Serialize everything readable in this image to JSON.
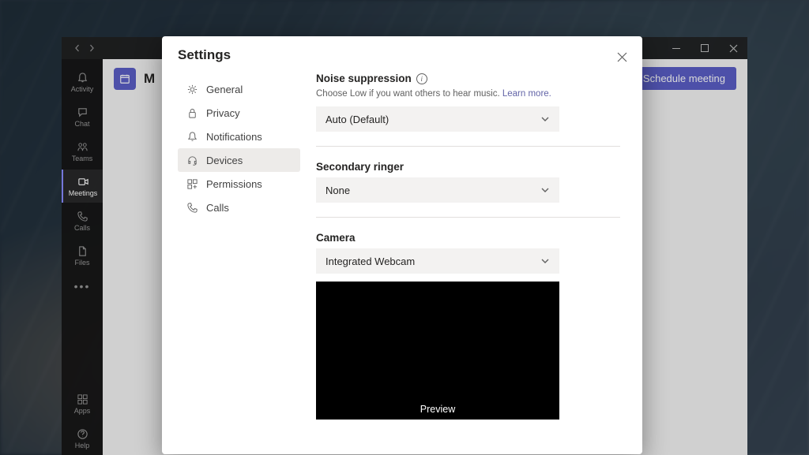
{
  "titlebar": {
    "minimize": "minimize",
    "maximize": "maximize",
    "close": "close"
  },
  "rail": {
    "items": [
      {
        "label": "Activity",
        "icon": "bell"
      },
      {
        "label": "Chat",
        "icon": "chat"
      },
      {
        "label": "Teams",
        "icon": "teams"
      },
      {
        "label": "Meetings",
        "icon": "meetings",
        "active": true
      },
      {
        "label": "Calls",
        "icon": "phone"
      },
      {
        "label": "Files",
        "icon": "files"
      }
    ],
    "bottom": [
      {
        "label": "Apps",
        "icon": "apps"
      },
      {
        "label": "Help",
        "icon": "help"
      }
    ]
  },
  "main": {
    "title_initial": "M",
    "schedule_button": "Schedule meeting"
  },
  "dialog": {
    "title": "Settings",
    "close": "Close",
    "nav": [
      {
        "label": "General",
        "icon": "gear"
      },
      {
        "label": "Privacy",
        "icon": "lock"
      },
      {
        "label": "Notifications",
        "icon": "bell"
      },
      {
        "label": "Devices",
        "icon": "headset",
        "active": true
      },
      {
        "label": "Permissions",
        "icon": "key"
      },
      {
        "label": "Calls",
        "icon": "phone"
      }
    ],
    "noise": {
      "title": "Noise suppression",
      "desc_a": "Choose Low if you want others to hear music. ",
      "learn_more": "Learn more.",
      "value": "Auto (Default)"
    },
    "ringer": {
      "title": "Secondary ringer",
      "value": "None"
    },
    "camera": {
      "title": "Camera",
      "value": "Integrated Webcam",
      "preview": "Preview"
    }
  }
}
